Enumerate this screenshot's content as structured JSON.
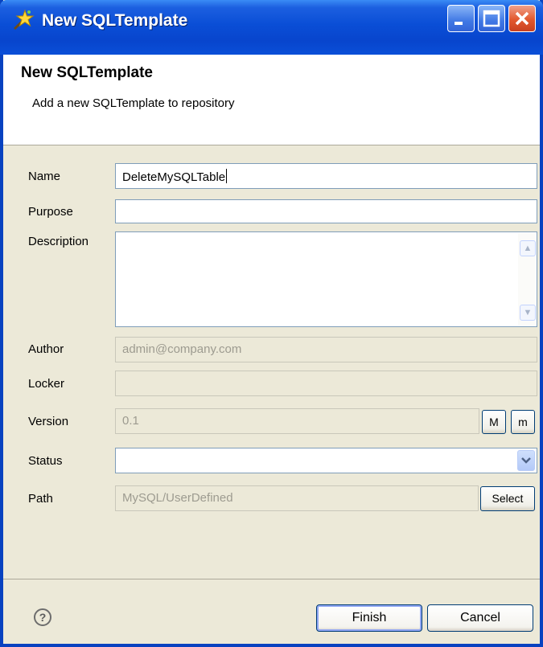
{
  "window": {
    "title": "New SQLTemplate"
  },
  "header": {
    "title": "New SQLTemplate",
    "description": "Add a new SQLTemplate to repository"
  },
  "form": {
    "name": {
      "label": "Name",
      "value": "DeleteMySQLTable"
    },
    "purpose": {
      "label": "Purpose",
      "value": ""
    },
    "description": {
      "label": "Description",
      "value": ""
    },
    "author": {
      "label": "Author",
      "value": "admin@company.com"
    },
    "locker": {
      "label": "Locker",
      "value": ""
    },
    "version": {
      "label": "Version",
      "value": "0.1",
      "major_button": "M",
      "minor_button": "m"
    },
    "status": {
      "label": "Status",
      "value": ""
    },
    "path": {
      "label": "Path",
      "value": "MySQL/UserDefined",
      "select_button": "Select"
    }
  },
  "footer": {
    "help_icon": "?",
    "finish_label": "Finish",
    "cancel_label": "Cancel"
  },
  "icons": {
    "app": "star-wand-icon",
    "help": "question-circle-icon",
    "dropdown": "chevron-down-icon"
  },
  "colors": {
    "titlebar": "#0a4ed6",
    "close_button": "#e2582e",
    "dialog_background": "#ece9d8"
  }
}
